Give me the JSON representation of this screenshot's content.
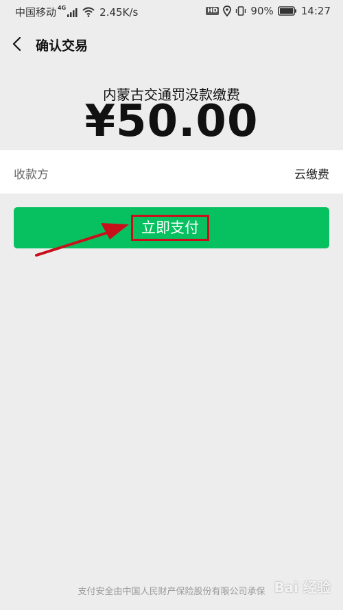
{
  "status_bar": {
    "carrier": "中国移动",
    "network_type": "4G",
    "speed": "2.45K/s",
    "hd_badge": "HD",
    "battery": "90%",
    "time": "14:27"
  },
  "nav": {
    "title": "确认交易"
  },
  "transaction": {
    "merchant_name": "内蒙古交通罚没款缴费",
    "amount": "¥50.00",
    "payee_label": "收款方",
    "payee_value": "云缴费"
  },
  "pay_button": {
    "label": "立即支付",
    "color": "#07c160",
    "highlight_color": "#c8101a"
  },
  "footer": {
    "text": "支付安全由中国人民财产保险股份有限公司承保"
  },
  "watermark": {
    "text": "Bai 经验"
  },
  "icons": [
    "back-icon",
    "signal-icon",
    "wifi-icon",
    "location-icon",
    "vibrate-icon",
    "battery-icon"
  ]
}
